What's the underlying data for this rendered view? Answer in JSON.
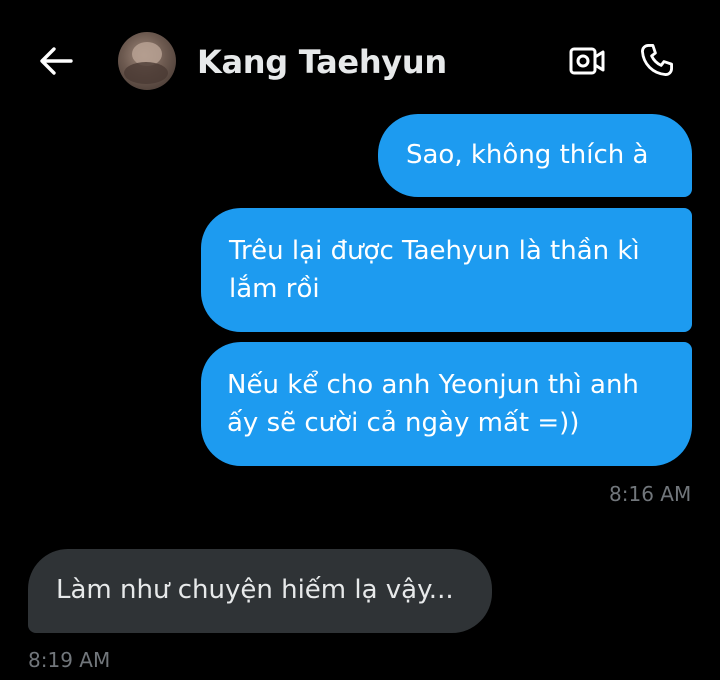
{
  "header": {
    "back_icon": "arrow-left-icon",
    "contact_name": "Kang Taehyun",
    "video_icon": "video-camera-icon",
    "call_icon": "phone-icon"
  },
  "messages": [
    {
      "direction": "sent",
      "text": "Sao, không thích à"
    },
    {
      "direction": "sent",
      "text": "Trêu lại được Taehyun là thần kì lắm rồi"
    },
    {
      "direction": "sent",
      "text": "Nếu kể cho anh Yeonjun thì anh ấy sẽ cười cả ngày mất =))"
    },
    {
      "direction": "received",
      "text": "Làm như chuyện hiếm lạ vậy..."
    }
  ],
  "timestamps": {
    "sent_group": "8:16 AM",
    "received_group": "8:19 AM"
  },
  "colors": {
    "background": "#000000",
    "sent_bubble": "#1d9bf0",
    "received_bubble": "#2f3336",
    "timestamp": "#71767b",
    "name_text": "#e7e9ea"
  }
}
